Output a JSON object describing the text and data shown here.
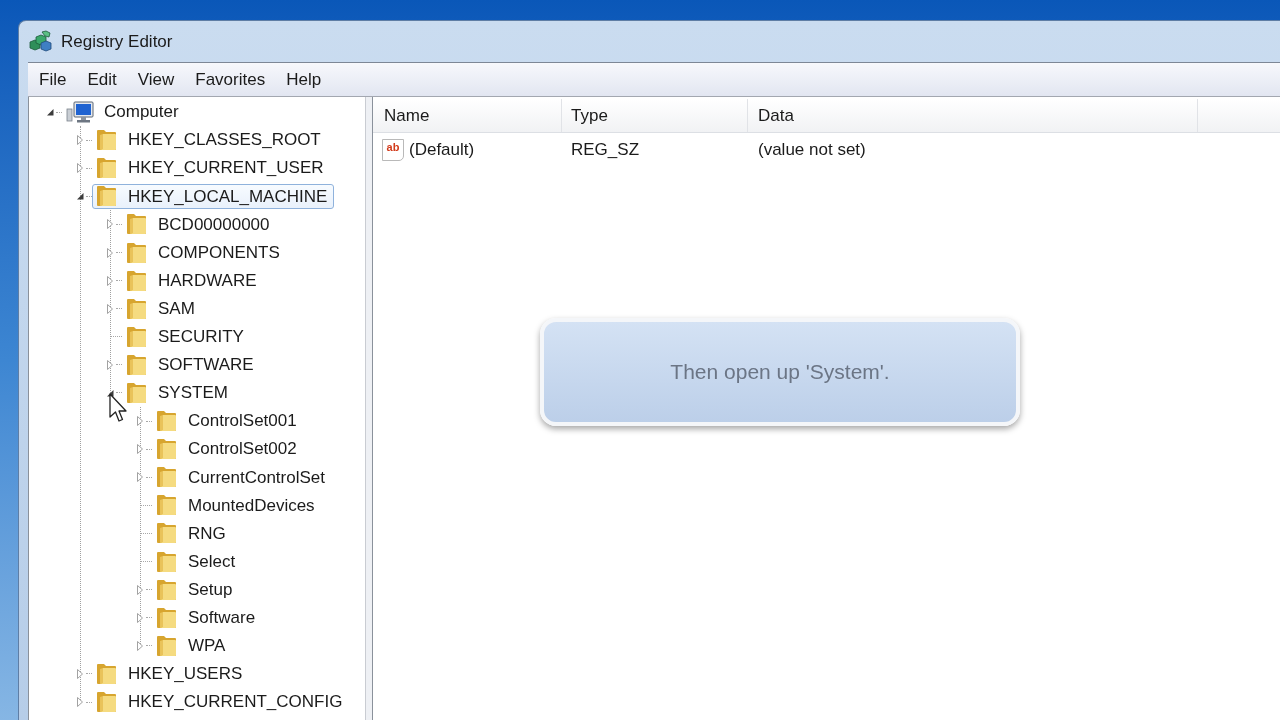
{
  "window": {
    "title": "Registry Editor"
  },
  "menu": [
    "File",
    "Edit",
    "View",
    "Favorites",
    "Help"
  ],
  "tree": [
    {
      "label": "Computer",
      "expanded": true,
      "selected": false,
      "children": [
        {
          "label": "HKEY_CLASSES_ROOT",
          "expanded": false,
          "selected": false
        },
        {
          "label": "HKEY_CURRENT_USER",
          "expanded": false,
          "selected": false
        },
        {
          "label": "HKEY_LOCAL_MACHINE",
          "expanded": true,
          "selected": true,
          "children": [
            {
              "label": "BCD00000000",
              "expanded": false,
              "selected": false
            },
            {
              "label": "COMPONENTS",
              "expanded": false,
              "selected": false
            },
            {
              "label": "HARDWARE",
              "expanded": false,
              "selected": false
            },
            {
              "label": "SAM",
              "expanded": false,
              "selected": false
            },
            {
              "label": "SECURITY",
              "selected": false
            },
            {
              "label": "SOFTWARE",
              "expanded": false,
              "selected": false
            },
            {
              "label": "SYSTEM",
              "expanded": true,
              "selected": false,
              "children": [
                {
                  "label": "ControlSet001",
                  "expanded": false,
                  "selected": false
                },
                {
                  "label": "ControlSet002",
                  "expanded": false,
                  "selected": false
                },
                {
                  "label": "CurrentControlSet",
                  "expanded": false,
                  "selected": false
                },
                {
                  "label": "MountedDevices",
                  "selected": false
                },
                {
                  "label": "RNG",
                  "selected": false
                },
                {
                  "label": "Select",
                  "selected": false
                },
                {
                  "label": "Setup",
                  "expanded": false,
                  "selected": false
                },
                {
                  "label": "Software",
                  "expanded": false,
                  "selected": false
                },
                {
                  "label": "WPA",
                  "expanded": false,
                  "selected": false
                }
              ]
            }
          ]
        },
        {
          "label": "HKEY_USERS",
          "expanded": false,
          "selected": false
        },
        {
          "label": "HKEY_CURRENT_CONFIG",
          "expanded": false,
          "selected": false
        }
      ]
    }
  ],
  "values_table": {
    "columns": [
      "Name",
      "Type",
      "Data"
    ],
    "rows": [
      {
        "icon": "ab",
        "name": "(Default)",
        "type": "REG_SZ",
        "data": "(value not set)"
      }
    ]
  },
  "callout": {
    "text": "Then open up 'System'."
  }
}
